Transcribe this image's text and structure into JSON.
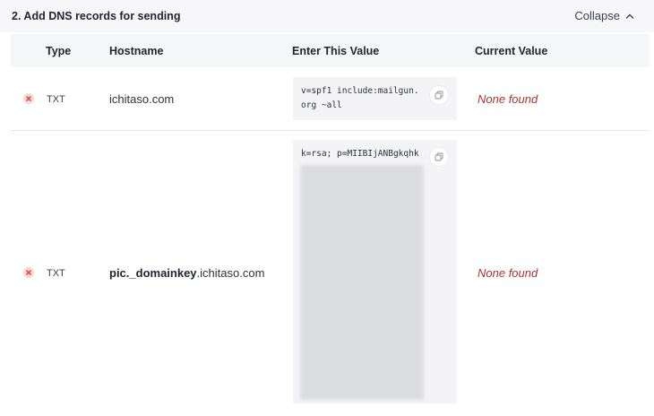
{
  "section": {
    "title": "2. Add DNS records for sending",
    "collapse_label": "Collapse"
  },
  "table": {
    "headers": [
      "Type",
      "Hostname",
      "Enter This Value",
      "Current Value"
    ],
    "rows": [
      {
        "status_icon": "x-error-icon",
        "type": "TXT",
        "hostname_prefix": "",
        "hostname_domain": "ichitaso.com",
        "value_line1": "v=spf1 include:mailgun.",
        "value_line2": "org ~all",
        "current": "None found"
      },
      {
        "status_icon": "x-error-icon",
        "type": "TXT",
        "hostname_prefix": "pic._domainkey",
        "hostname_domain": ".ichitaso.com",
        "value_line1": "k=rsa; p=MIIBIjANBgkqhk",
        "current": "None found"
      }
    ]
  },
  "colors": {
    "error_red": "#b0322e",
    "status_icon_red": "#d9534f"
  }
}
